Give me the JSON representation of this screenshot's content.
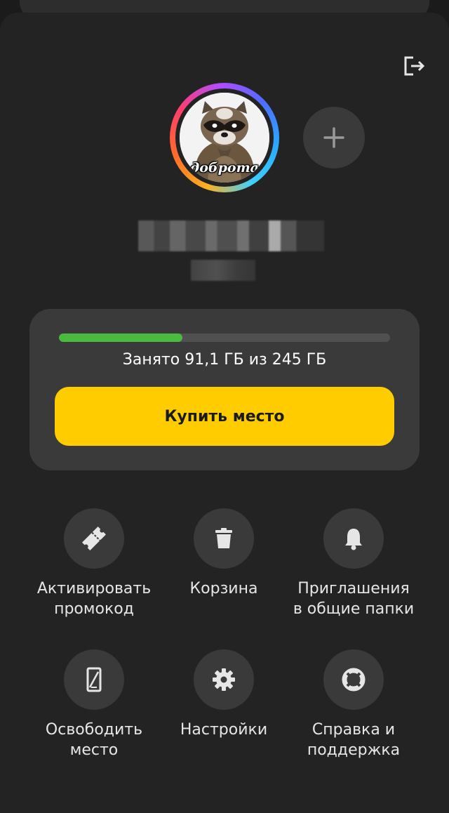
{
  "profile": {
    "avatar_caption": "доброта"
  },
  "storage": {
    "used_fraction": 0.372,
    "used_text": "Занято 91,1 ГБ из 245 ГБ",
    "buy_label": "Купить место"
  },
  "actions": [
    {
      "label": "Активировать\nпромокод",
      "icon": "ticket-icon"
    },
    {
      "label": "Корзина",
      "icon": "trash-icon"
    },
    {
      "label": "Приглашения\nв общие папки",
      "icon": "bell-icon"
    },
    {
      "label": "Освободить\nместо",
      "icon": "phone-cleanup-icon"
    },
    {
      "label": "Настройки",
      "icon": "gear-icon"
    },
    {
      "label": "Справка и\nподдержка",
      "icon": "lifebuoy-icon"
    }
  ],
  "colors": {
    "accent": "#ffcc00",
    "progress": "#4bbb3f",
    "background": "#232323",
    "card": "#3a3a3a"
  }
}
